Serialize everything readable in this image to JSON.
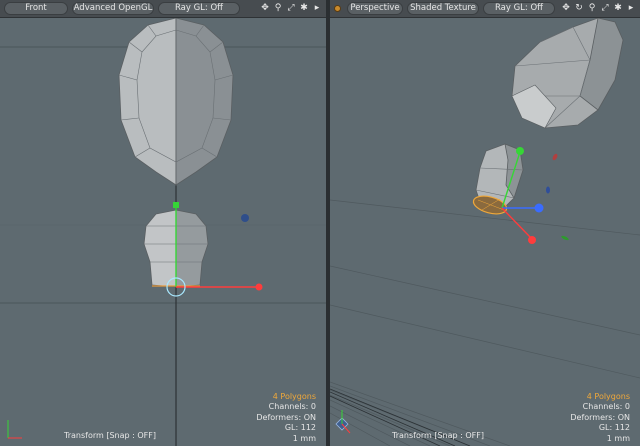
{
  "left_viewport": {
    "view_mode": "Front",
    "shading": "Advanced OpenGL",
    "raygl": "Ray GL: Off",
    "tool_status": "Transform  [Snap : OFF]",
    "info": {
      "polygons": "4 Polygons",
      "channels": "Channels: 0",
      "deformers": "Deformers: ON",
      "gl": "GL: 112",
      "unit": "1 mm"
    }
  },
  "right_viewport": {
    "view_mode": "Perspective",
    "shading": "Shaded Texture",
    "raygl": "Ray GL: Off",
    "tool_status": "Transform  [Snap : OFF]",
    "info": {
      "polygons": "4 Polygons",
      "channels": "Channels: 0",
      "deformers": "Deformers: ON",
      "gl": "GL: 112",
      "unit": "1 mm"
    }
  },
  "icons": [
    "move-icon",
    "search-icon",
    "fit-icon",
    "gear-icon",
    "menu-arrow-icon"
  ],
  "colors": {
    "viewport_bg": "#5e6a70",
    "toolbar_bg": "#474c50",
    "polycount": "#f0a83a",
    "axis_x": "#ff3c3c",
    "axis_y": "#36d636",
    "axis_z": "#3a6cff"
  }
}
